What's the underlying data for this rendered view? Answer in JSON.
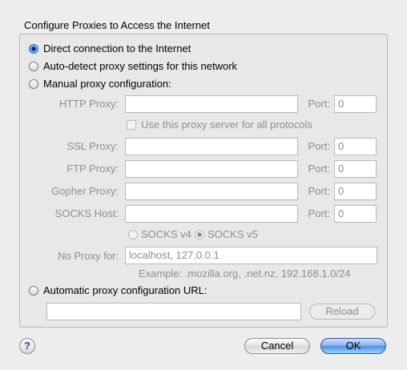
{
  "dialog": {
    "title": "Configure Proxies to Access the Internet",
    "options": {
      "direct": "Direct connection to the Internet",
      "auto_detect": "Auto-detect proxy settings for this network",
      "manual": "Manual proxy configuration:",
      "auto_url": "Automatic proxy configuration URL:"
    },
    "selected_option": "direct",
    "manual": {
      "http_label": "HTTP Proxy:",
      "http_value": "",
      "http_port": "0",
      "use_for_all_label": "Use this proxy server for all protocols",
      "use_for_all_checked": false,
      "ssl_label": "SSL Proxy:",
      "ssl_value": "",
      "ssl_port": "0",
      "ftp_label": "FTP Proxy:",
      "ftp_value": "",
      "ftp_port": "0",
      "gopher_label": "Gopher Proxy:",
      "gopher_value": "",
      "gopher_port": "0",
      "socks_label": "SOCKS Host:",
      "socks_value": "",
      "socks_port": "0",
      "port_label": "Port:",
      "socks_v4": "SOCKS v4",
      "socks_v5": "SOCKS v5",
      "socks_version_selected": "v5",
      "no_proxy_label": "No Proxy for:",
      "no_proxy_value": "localhost, 127.0.0.1",
      "example": "Example: .mozilla.org, .net.nz, 192.168.1.0/24"
    },
    "auto_url_value": "",
    "reload_label": "Reload",
    "help_label": "?",
    "cancel_label": "Cancel",
    "ok_label": "OK"
  }
}
